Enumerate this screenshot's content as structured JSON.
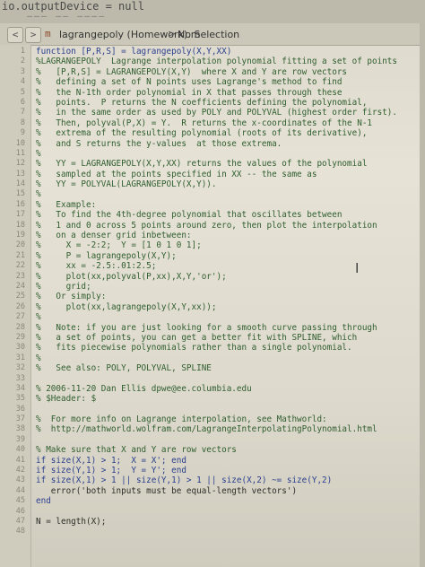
{
  "console": {
    "line": "io.outputDevice = null",
    "ghost": "——— —— ————"
  },
  "tabbar": {
    "back_label": "<",
    "forward_label": ">",
    "file_icon": "m",
    "file_title": "lagrangepoly (Homework).m",
    "separator": ">",
    "selection": "No Selection"
  },
  "editor": {
    "lines": [
      {
        "n": "1",
        "t": "function [P,R,S] = lagrangepoly(X,Y,XX)",
        "k": "kw"
      },
      {
        "n": "2",
        "t": "%LAGRANGEPOLY  Lagrange interpolation polynomial fitting a set of points",
        "k": "cm"
      },
      {
        "n": "3",
        "t": "%   [P,R,S] = LAGRANGEPOLY(X,Y)  where X and Y are row vectors",
        "k": "cm"
      },
      {
        "n": "4",
        "t": "%   defining a set of N points uses Lagrange's method to find",
        "k": "cm"
      },
      {
        "n": "5",
        "t": "%   the N-1th order polynomial in X that passes through these",
        "k": "cm"
      },
      {
        "n": "6",
        "t": "%   points.  P returns the N coefficients defining the polynomial,",
        "k": "cm"
      },
      {
        "n": "7",
        "t": "%   in the same order as used by POLY and POLYVAL (highest order first).",
        "k": "cm"
      },
      {
        "n": "8",
        "t": "%   Then, polyval(P,X) = Y.  R returns the x-coordinates of the N-1",
        "k": "cm"
      },
      {
        "n": "9",
        "t": "%   extrema of the resulting polynomial (roots of its derivative),",
        "k": "cm"
      },
      {
        "n": "10",
        "t": "%   and S returns the y-values  at those extrema.",
        "k": "cm"
      },
      {
        "n": "11",
        "t": "%",
        "k": "cm"
      },
      {
        "n": "12",
        "t": "%   YY = LAGRANGEPOLY(X,Y,XX) returns the values of the polynomial",
        "k": "cm"
      },
      {
        "n": "13",
        "t": "%   sampled at the points specified in XX -- the same as",
        "k": "cm"
      },
      {
        "n": "14",
        "t": "%   YY = POLYVAL(LAGRANGEPOLY(X,Y)).",
        "k": "cm"
      },
      {
        "n": "15",
        "t": "%",
        "k": "cm"
      },
      {
        "n": "16",
        "t": "%   Example:",
        "k": "cm"
      },
      {
        "n": "17",
        "t": "%   To find the 4th-degree polynomial that oscillates between",
        "k": "cm"
      },
      {
        "n": "18",
        "t": "%   1 and 0 across 5 points around zero, then plot the interpolation",
        "k": "cm"
      },
      {
        "n": "19",
        "t": "%   on a denser grid inbetween:",
        "k": "cm"
      },
      {
        "n": "20",
        "t": "%     X = -2:2;  Y = [1 0 1 0 1];",
        "k": "cm"
      },
      {
        "n": "21",
        "t": "%     P = lagrangepoly(X,Y);",
        "k": "cm"
      },
      {
        "n": "22",
        "t": "%     xx = -2.5:.01:2.5;",
        "k": "cm"
      },
      {
        "n": "23",
        "t": "%     plot(xx,polyval(P,xx),X,Y,'or');",
        "k": "cm"
      },
      {
        "n": "24",
        "t": "%     grid;",
        "k": "cm"
      },
      {
        "n": "25",
        "t": "%   Or simply:",
        "k": "cm"
      },
      {
        "n": "26",
        "t": "%     plot(xx,lagrangepoly(X,Y,xx));",
        "k": "cm"
      },
      {
        "n": "27",
        "t": "%",
        "k": "cm"
      },
      {
        "n": "28",
        "t": "%   Note: if you are just looking for a smooth curve passing through",
        "k": "cm"
      },
      {
        "n": "29",
        "t": "%   a set of points, you can get a better fit with SPLINE, which",
        "k": "cm"
      },
      {
        "n": "30",
        "t": "%   fits piecewise polynomials rather than a single polynomial.",
        "k": "cm"
      },
      {
        "n": "31",
        "t": "%",
        "k": "cm"
      },
      {
        "n": "32",
        "t": "%   See also: POLY, POLYVAL, SPLINE",
        "k": "cm"
      },
      {
        "n": "33",
        "t": "",
        "k": ""
      },
      {
        "n": "34",
        "t": "% 2006-11-20 Dan Ellis dpwe@ee.columbia.edu",
        "k": "cm"
      },
      {
        "n": "35",
        "t": "% $Header: $",
        "k": "cm"
      },
      {
        "n": "36",
        "t": "",
        "k": ""
      },
      {
        "n": "37",
        "t": "%  For more info on Lagrange interpolation, see Mathworld:",
        "k": "cm"
      },
      {
        "n": "38",
        "t": "%  http://mathworld.wolfram.com/LagrangeInterpolatingPolynomial.html",
        "k": "link"
      },
      {
        "n": "39",
        "t": "",
        "k": ""
      },
      {
        "n": "40",
        "t": "% Make sure that X and Y are row vectors",
        "k": "cm"
      },
      {
        "n": "41",
        "t": "if size(X,1) > 1;  X = X'; end",
        "k": "kw"
      },
      {
        "n": "42",
        "t": "if size(Y,1) > 1;  Y = Y'; end",
        "k": "kw"
      },
      {
        "n": "43",
        "t": "if size(X,1) > 1 || size(Y,1) > 1 || size(X,2) ~= size(Y,2)",
        "k": "kw"
      },
      {
        "n": "44",
        "t": "   error('both inputs must be equal-length vectors')",
        "k": ""
      },
      {
        "n": "45",
        "t": "end",
        "k": "kw"
      },
      {
        "n": "46",
        "t": "",
        "k": ""
      },
      {
        "n": "47",
        "t": "N = length(X);",
        "k": ""
      },
      {
        "n": "48",
        "t": "",
        "k": ""
      }
    ]
  }
}
